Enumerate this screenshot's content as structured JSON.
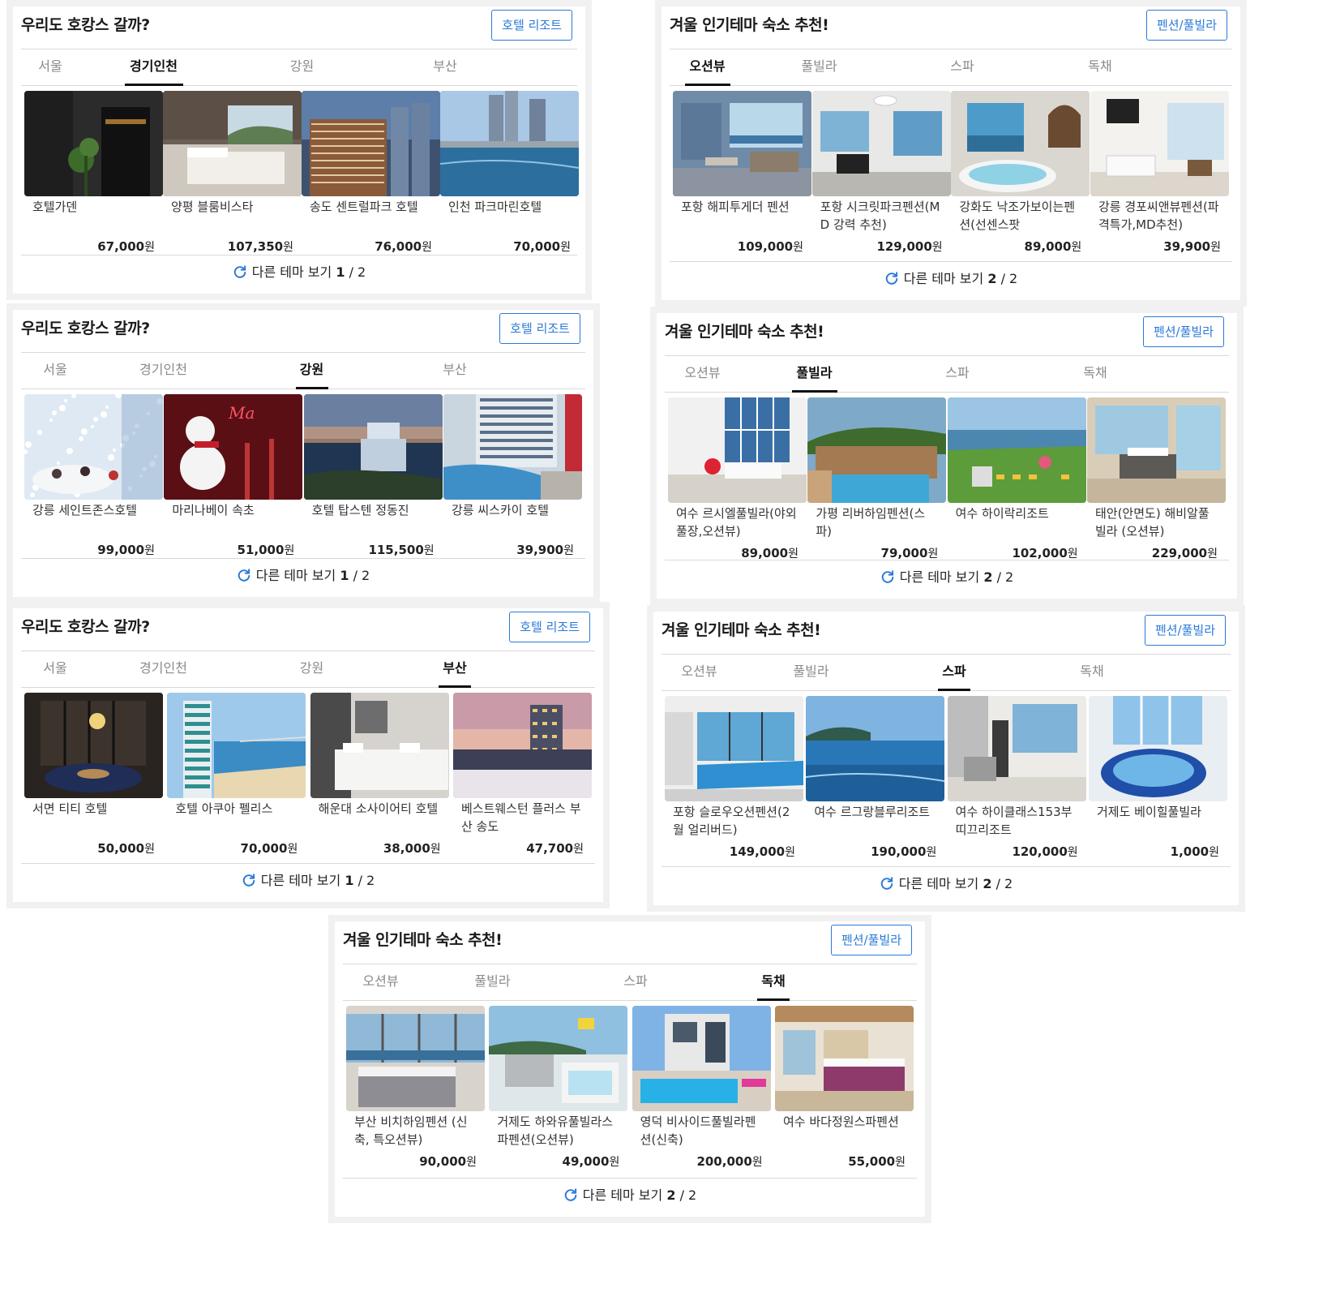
{
  "panels": [
    {
      "title": "우리도 호캉스 갈까?",
      "button": "호텔 리조트",
      "tabs": [
        "서울",
        "경기인천",
        "강원",
        "부산"
      ],
      "active_tab": 1,
      "cards": [
        {
          "name": "호텔가덴",
          "price": "67,000",
          "img": "dark-lobby"
        },
        {
          "name": "양평 블룸비스타",
          "price": "107,350",
          "img": "bedroom-view"
        },
        {
          "name": "송도 센트럴파크 호텔",
          "price": "76,000",
          "img": "hotel-building-night"
        },
        {
          "name": "인천 파크마린호텔",
          "price": "70,000",
          "img": "rooftop-pool"
        }
      ],
      "footer": {
        "label": "다른 테마 보기",
        "page": "1",
        "total": "2"
      }
    },
    {
      "title": "겨울 인기테마 숙소 추천!",
      "button": "펜션/풀빌라",
      "tabs": [
        "오션뷰",
        "풀빌라",
        "스파",
        "독채"
      ],
      "active_tab": 0,
      "cards": [
        {
          "name": "포항 해피투게더 펜션",
          "price": "109,000",
          "img": "living-ocean"
        },
        {
          "name": "포항 시크릿파크펜션(MD 강력 추천)",
          "price": "129,000",
          "img": "white-living"
        },
        {
          "name": "강화도 낙조가보이는펜션(선센스팟",
          "price": "89,000",
          "img": "spa-window"
        },
        {
          "name": "강릉 경포씨앤뷰펜션(파격특가,MD추천)",
          "price": "39,900",
          "img": "white-room"
        }
      ],
      "footer": {
        "label": "다른 테마 보기",
        "page": "2",
        "total": "2"
      }
    },
    {
      "title": "우리도 호캉스 갈까?",
      "button": "호텔 리조트",
      "tabs": [
        "서울",
        "경기인천",
        "강원",
        "부산"
      ],
      "active_tab": 2,
      "cards": [
        {
          "name": "강릉 세인트존스호텔",
          "price": "99,000",
          "img": "snow-party"
        },
        {
          "name": "마리나베이 속초",
          "price": "51,000",
          "img": "snowman-red"
        },
        {
          "name": "호텔 탑스텐 정동진",
          "price": "115,500",
          "img": "coast-hotel"
        },
        {
          "name": "강릉 씨스카이 호텔",
          "price": "39,900",
          "img": "infinity-pool"
        }
      ],
      "footer": {
        "label": "다른 테마 보기",
        "page": "1",
        "total": "2"
      }
    },
    {
      "title": "겨울 인기테마 숙소 추천!",
      "button": "펜션/풀빌라",
      "tabs": [
        "오션뷰",
        "풀빌라",
        "스파",
        "독채"
      ],
      "active_tab": 1,
      "cards": [
        {
          "name": "여수 르시엘풀빌라(야외풀장,오션뷰)",
          "price": "89,000",
          "img": "loft-blue"
        },
        {
          "name": "가평 리버하임펜션(스파)",
          "price": "79,000",
          "img": "villa-pool"
        },
        {
          "name": "여수 하이락리조트",
          "price": "102,000",
          "img": "lawn-sea"
        },
        {
          "name": "태안(안면도) 해비알풀빌라 (오션뷰)",
          "price": "229,000",
          "img": "dining-sea"
        }
      ],
      "footer": {
        "label": "다른 테마 보기",
        "page": "2",
        "total": "2"
      }
    },
    {
      "title": "우리도 호캉스 갈까?",
      "button": "호텔 리조트",
      "tabs": [
        "서울",
        "경기인천",
        "강원",
        "부산"
      ],
      "active_tab": 3,
      "cards": [
        {
          "name": "서면 티티 호텔",
          "price": "50,000",
          "img": "dark-suite"
        },
        {
          "name": "호텔 아쿠아 펠리스",
          "price": "70,000",
          "img": "beach-tower"
        },
        {
          "name": "해운대 소사이어티 호텔",
          "price": "38,000",
          "img": "twin-beds"
        },
        {
          "name": "베스트웨스턴 플러스 부산 송도",
          "price": "47,700",
          "img": "dusk-city"
        }
      ],
      "footer": {
        "label": "다른 테마 보기",
        "page": "1",
        "total": "2"
      }
    },
    {
      "title": "겨울 인기테마 숙소 추천!",
      "button": "펜션/풀빌라",
      "tabs": [
        "오션뷰",
        "풀빌라",
        "스파",
        "독채"
      ],
      "active_tab": 2,
      "cards": [
        {
          "name": "포항 슬로우오션펜션(2월 얼리버드)",
          "price": "149,000",
          "img": "indoor-pool"
        },
        {
          "name": "여수 르그랑블루리조트",
          "price": "190,000",
          "img": "infinity-sea"
        },
        {
          "name": "여수 하이클래스153부띠끄리조트",
          "price": "120,000",
          "img": "marble-room"
        },
        {
          "name": "거제도 베이힐풀빌라",
          "price": "1,000",
          "img": "jacuzzi-blue"
        }
      ],
      "footer": {
        "label": "다른 테마 보기",
        "page": "2",
        "total": "2"
      }
    },
    {
      "title": "겨울 인기테마 숙소 추천!",
      "button": "펜션/풀빌라",
      "tabs": [
        "오션뷰",
        "풀빌라",
        "스파",
        "독채"
      ],
      "active_tab": 3,
      "cards": [
        {
          "name": "부산 비치하임펜션 (신축, 특오션뷰)",
          "price": "90,000",
          "img": "bed-ocean"
        },
        {
          "name": "거제도 하와유풀빌라스파펜션(오션뷰)",
          "price": "49,000",
          "img": "balcony-tub"
        },
        {
          "name": "영덕 비사이드풀빌라펜션(신축)",
          "price": "200,000",
          "img": "modern-villa"
        },
        {
          "name": "여수 바다정원스파펜션",
          "price": "55,000",
          "img": "wood-room"
        }
      ],
      "footer": {
        "label": "다른 테마 보기",
        "page": "2",
        "total": "2"
      }
    }
  ],
  "price_unit": "원",
  "colors": {
    "accent": "#2a7ad8",
    "border": "#d9d9d9",
    "panel_frame": "#f1f1f1"
  }
}
